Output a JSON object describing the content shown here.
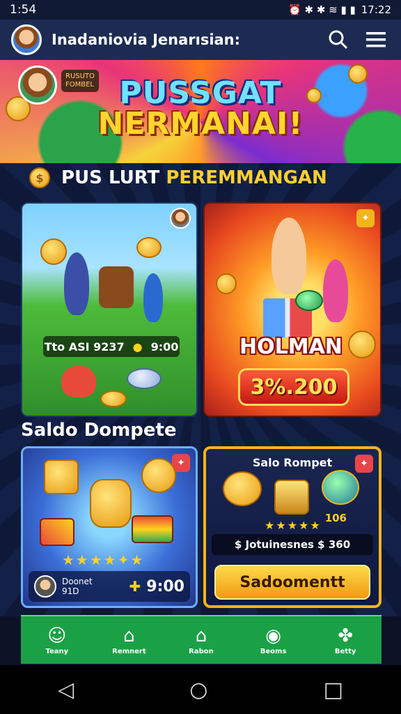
{
  "status": {
    "time": "1:54",
    "right_time": "17:22",
    "icons": "⏰ ✱ ✱ ≋ ▮ ▮"
  },
  "app": {
    "title": "Inadaniovia Jenarısian:"
  },
  "banner": {
    "tag_line1": "RUSUTO",
    "tag_line2": "FOMBEL",
    "title_line1": "PUSSGAT",
    "title_line2": "NERMANAI!"
  },
  "section": {
    "title_part1": "PUS LURT",
    "title_part2": "PEREMMANGAN"
  },
  "card1": {
    "stat": "Tto ASI 9237",
    "amount": "9:00"
  },
  "card2": {
    "label": "HOLMAN",
    "price": "3%.200"
  },
  "wallet": {
    "heading": "Saldo Dompete",
    "left": {
      "label_line1": "Doonet",
      "label_line2": "91D",
      "amount": "9:00"
    },
    "right": {
      "title": "Salo Rompet",
      "value": "106",
      "row": "$ Jotuinesnes $ 360",
      "button": "Sadoomentt"
    }
  },
  "nav": [
    {
      "label": "Teany",
      "icon": "person-icon"
    },
    {
      "label": "Remnert",
      "icon": "home-icon"
    },
    {
      "label": "Rabon",
      "icon": "house-icon"
    },
    {
      "label": "Beoms",
      "icon": "camera-icon"
    },
    {
      "label": "Betty",
      "icon": "puzzle-icon"
    }
  ],
  "colors": {
    "accent": "#ffcf2e",
    "nav": "#1aa146",
    "appbar": "#1d2b52"
  }
}
